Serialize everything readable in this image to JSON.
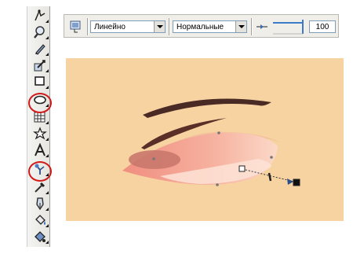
{
  "property_bar": {
    "fill_type": "Линейно",
    "blend_mode": "Нормальные",
    "opacity_value": "100"
  },
  "toolbox": {
    "tools": [
      "shape-tool-icon",
      "zoom-tool-icon",
      "freehand-tool-icon",
      "smart-fill-tool-icon",
      "rectangle-tool-icon",
      "ellipse-tool-icon",
      "polygon-tool-icon",
      "basic-shapes-tool-icon",
      "text-tool-icon",
      "interactive-transparency-tool-icon",
      "eyedropper-tool-icon",
      "outline-pen-tool-icon",
      "fill-tool-icon",
      "interactive-fill-tool-icon"
    ],
    "highlighted": [
      "ellipse-tool-icon",
      "interactive-transparency-tool-icon"
    ]
  },
  "colors": {
    "canvas_background": "#f8d3a2",
    "highlight_ring": "#d11a1a",
    "eyebrow": "#4a2a24",
    "eye_shape": "#f4a48f",
    "iris": "#c9786b"
  }
}
